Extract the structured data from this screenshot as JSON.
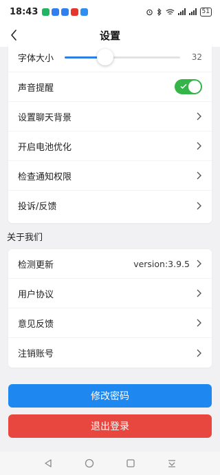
{
  "status_bar": {
    "time": "18:43",
    "battery": "51",
    "app_icon_colors": [
      "#20b463",
      "#2f7ff0",
      "#2f7ff0",
      "#e6352f",
      "#2f8ff0"
    ]
  },
  "header": {
    "title": "设置"
  },
  "settings": {
    "font_size_label": "字体大小",
    "font_size_value": "32",
    "font_size_fraction": 0.35,
    "sound_label": "声音提醒",
    "sound_on": true,
    "chat_bg_label": "设置聊天背景",
    "battery_opt_label": "开启电池优化",
    "notify_perm_label": "检查通知权限",
    "complaint_label": "投诉/反馈"
  },
  "about": {
    "section_title": "关于我们",
    "update_label": "检测更新",
    "version": "version:3.9.5",
    "agreement_label": "用户协议",
    "feedback_label": "意见反馈",
    "cancel_account_label": "注销账号"
  },
  "buttons": {
    "change_password": "修改密码",
    "logout": "退出登录"
  },
  "colors": {
    "accent_blue": "#1e88f0",
    "danger_red": "#e8473f",
    "toggle_green": "#35b44a",
    "slider_blue": "#2e7ee6"
  }
}
